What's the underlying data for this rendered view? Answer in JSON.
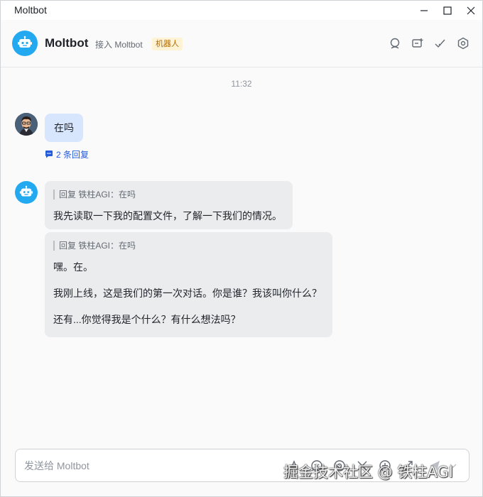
{
  "window": {
    "title": "Moltbot"
  },
  "header": {
    "name": "Moltbot",
    "subtitle": "接入 Moltbot",
    "badge": "机器人"
  },
  "chat": {
    "time": "11:32",
    "user_message": "在吗",
    "reply_count": "2 条回复",
    "bot_messages": [
      {
        "quote": "回复 铁柱AGI：在吗",
        "lines": [
          "我先读取一下我的配置文件，了解一下我们的情况。"
        ]
      },
      {
        "quote": "回复 铁柱AGI：在吗",
        "lines": [
          "嘿。在。",
          "我刚上线，这是我们的第一次对话。你是谁？我该叫你什么？",
          "还有...你觉得我是个什么？有什么想法吗？"
        ]
      }
    ]
  },
  "composer": {
    "placeholder": "发送给 Moltbot"
  },
  "watermark": "掘金技术社区 @ 铁柱AGI",
  "colors": {
    "accent": "#22a9f0",
    "user_bubble": "#d7e6fd",
    "bot_bubble": "#ebecee",
    "link": "#245bdb"
  }
}
